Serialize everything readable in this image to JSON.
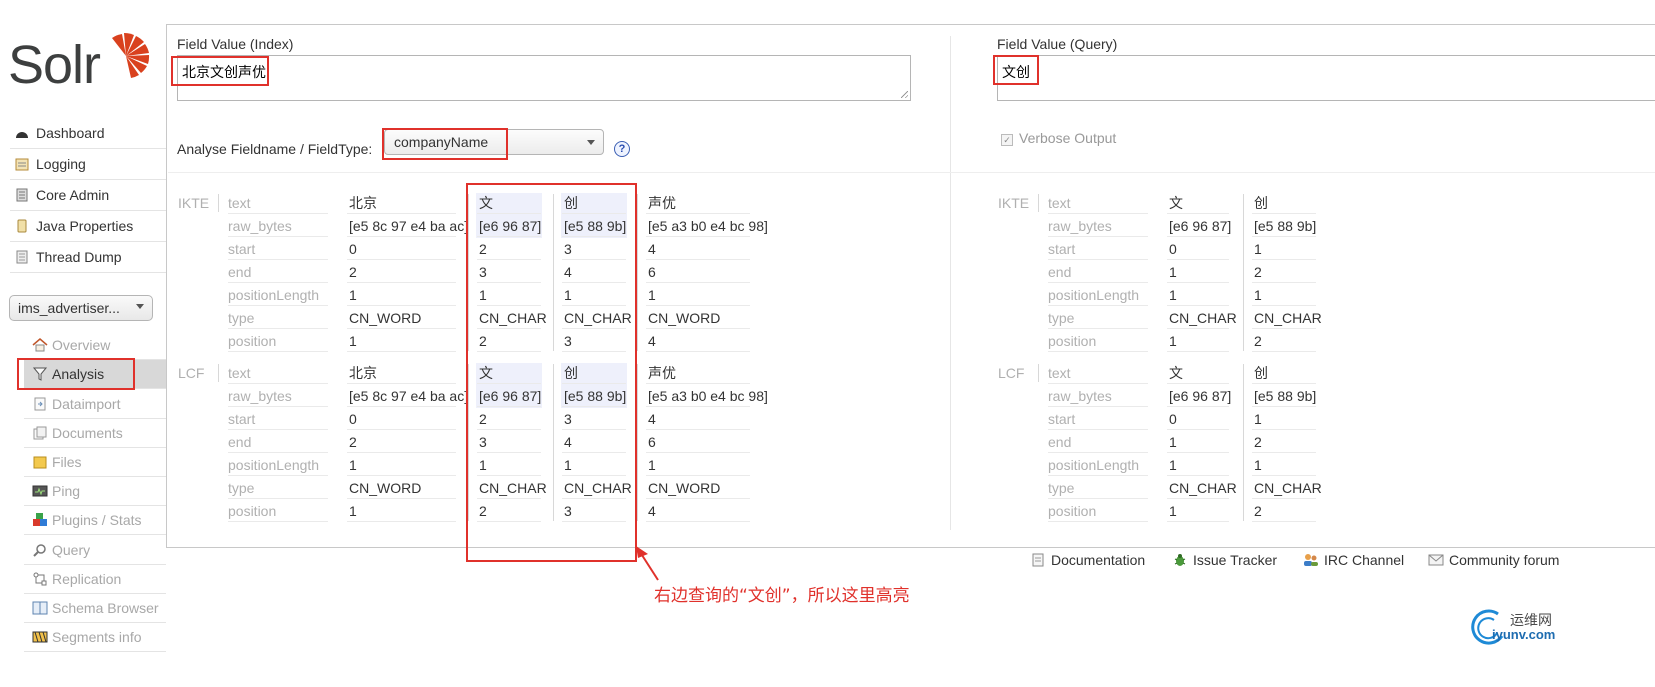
{
  "logo": {
    "text": "Solr"
  },
  "sidebar": {
    "items": [
      {
        "label": "Dashboard",
        "icon": "dashboard-icon"
      },
      {
        "label": "Logging",
        "icon": "logging-icon"
      },
      {
        "label": "Core Admin",
        "icon": "core-admin-icon"
      },
      {
        "label": "Java Properties",
        "icon": "java-icon"
      },
      {
        "label": "Thread Dump",
        "icon": "thread-dump-icon"
      }
    ],
    "core_selector": "ims_advertiser...",
    "core_items": [
      {
        "label": "Overview",
        "icon": "home-icon"
      },
      {
        "label": "Analysis",
        "icon": "funnel-icon",
        "active": true
      },
      {
        "label": "Dataimport",
        "icon": "dataimport-icon"
      },
      {
        "label": "Documents",
        "icon": "documents-icon"
      },
      {
        "label": "Files",
        "icon": "folder-icon"
      },
      {
        "label": "Ping",
        "icon": "ping-icon"
      },
      {
        "label": "Plugins / Stats",
        "icon": "plugins-icon"
      },
      {
        "label": "Query",
        "icon": "search-icon"
      },
      {
        "label": "Replication",
        "icon": "replication-icon"
      },
      {
        "label": "Schema Browser",
        "icon": "schema-icon"
      },
      {
        "label": "Segments info",
        "icon": "segments-icon"
      }
    ]
  },
  "analysis": {
    "index_label": "Field Value (Index)",
    "index_value": "北京文创声优",
    "query_label": "Field Value (Query)",
    "query_value": "文创",
    "fieldtype_label": "Analyse Fieldname / FieldType:",
    "fieldtype_value": "companyName",
    "help": "?",
    "verbose_label": "Verbose Output",
    "verbose_checked": true
  },
  "attr_names": [
    "text",
    "raw_bytes",
    "start",
    "end",
    "positionLength",
    "type",
    "position"
  ],
  "index_stages": [
    {
      "name": "IKTE",
      "tokens": [
        [
          "北京",
          "[e5 8c 97 e4 ba ac]",
          "0",
          "2",
          "1",
          "CN_WORD",
          "1"
        ],
        [
          "文",
          "[e6 96 87]",
          "2",
          "3",
          "1",
          "CN_CHAR",
          "2"
        ],
        [
          "创",
          "[e5 88 9b]",
          "3",
          "4",
          "1",
          "CN_CHAR",
          "3"
        ],
        [
          "声优",
          "[e5 a3 b0 e4 bc 98]",
          "4",
          "6",
          "1",
          "CN_WORD",
          "4"
        ]
      ]
    },
    {
      "name": "LCF",
      "tokens": [
        [
          "北京",
          "[e5 8c 97 e4 ba ac]",
          "0",
          "2",
          "1",
          "CN_WORD",
          "1"
        ],
        [
          "文",
          "[e6 96 87]",
          "2",
          "3",
          "1",
          "CN_CHAR",
          "2"
        ],
        [
          "创",
          "[e5 88 9b]",
          "3",
          "4",
          "1",
          "CN_CHAR",
          "3"
        ],
        [
          "声优",
          "[e5 a3 b0 e4 bc 98]",
          "4",
          "6",
          "1",
          "CN_WORD",
          "4"
        ]
      ]
    }
  ],
  "query_stages": [
    {
      "name": "IKTE",
      "tokens": [
        [
          "文",
          "[e6 96 87]",
          "0",
          "1",
          "1",
          "CN_CHAR",
          "1"
        ],
        [
          "创",
          "[e5 88 9b]",
          "1",
          "2",
          "1",
          "CN_CHAR",
          "2"
        ]
      ]
    },
    {
      "name": "LCF",
      "tokens": [
        [
          "文",
          "[e6 96 87]",
          "0",
          "1",
          "1",
          "CN_CHAR",
          "1"
        ],
        [
          "创",
          "[e5 88 9b]",
          "1",
          "2",
          "1",
          "CN_CHAR",
          "2"
        ]
      ]
    }
  ],
  "annotation": {
    "note": "右边查询的“文创”，所以这里高亮",
    "color": "#e0312b"
  },
  "footer": {
    "documentation": "Documentation",
    "issue_tracker": "Issue Tracker",
    "irc_channel": "IRC Channel",
    "community_forum": "Community forum"
  },
  "watermark": {
    "top": "运维网",
    "bottom": "iyunv.com"
  }
}
